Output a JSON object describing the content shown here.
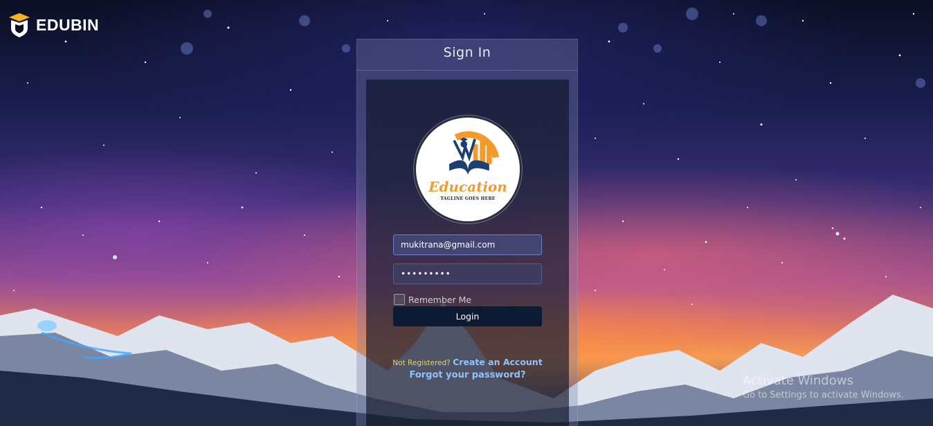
{
  "brand": {
    "name": "EDUBIN"
  },
  "signin": {
    "title": "Sign In",
    "logo": {
      "main_text": "Education",
      "tagline": "TAGLINE GOES HERE"
    },
    "email_value": "mukitrana@gmail.com",
    "password_value": "•••••••••",
    "remember_label": "Remember Me",
    "login_label": "Login",
    "not_registered": "Not Registered?",
    "create_account": "Create an Account",
    "forgot_password": "Forgot your password?"
  },
  "watermark": {
    "title": "Activate Windows",
    "subtitle": "Go to Settings to activate Windows."
  },
  "colors": {
    "accent_link": "#8fc3ff",
    "question_text": "#e6d770",
    "login_button": "#0d1a33",
    "logo_orange": "#f39a2b",
    "logo_blue": "#1c3f74"
  }
}
